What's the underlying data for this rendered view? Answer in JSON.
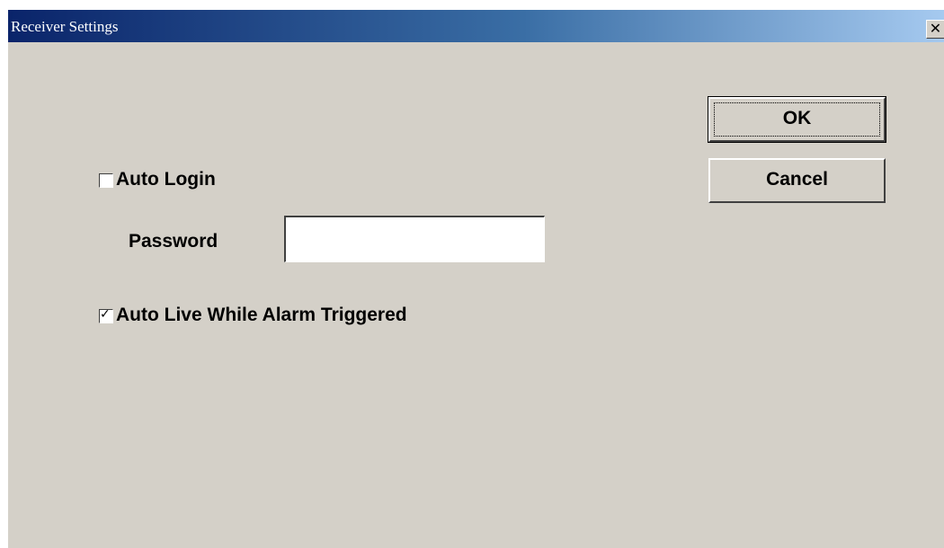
{
  "window": {
    "title": "Receiver Settings",
    "close_glyph": "✕"
  },
  "buttons": {
    "ok_label": "OK",
    "cancel_label": "Cancel"
  },
  "options": {
    "auto_login": {
      "label": "Auto Login",
      "checked": false
    },
    "password": {
      "label": "Password",
      "value": ""
    },
    "auto_live": {
      "label": "Auto Live While Alarm Triggered",
      "checked": true,
      "check_glyph": "✓"
    }
  }
}
